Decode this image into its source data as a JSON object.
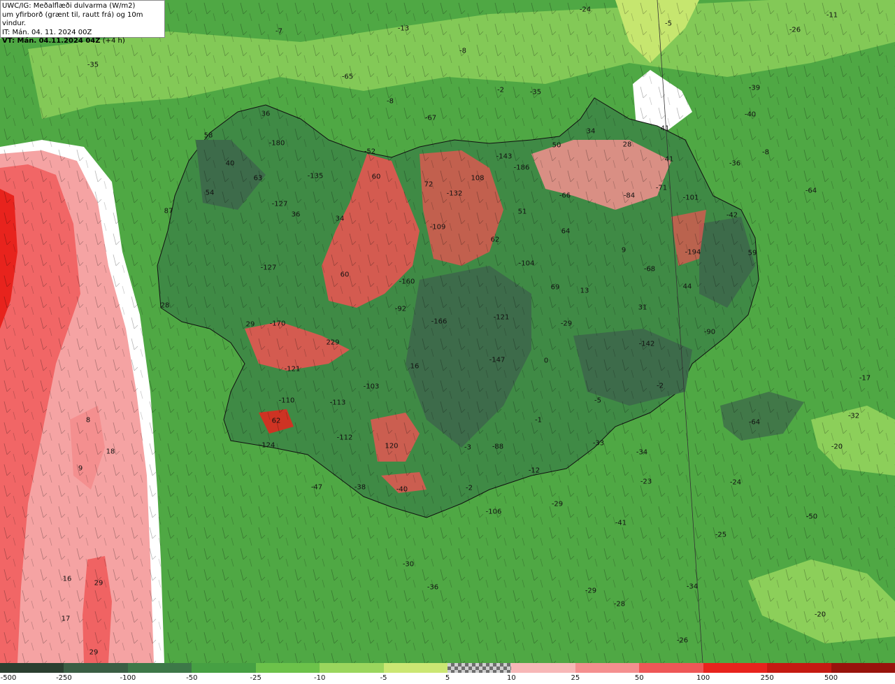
{
  "header": {
    "title_line1": "UWC/IG: Meðalflæði dulvarma (W/m2)",
    "title_line2": "um yfirborð (grænt til, rautt frá) og 10m vindur.",
    "init_time": "IT: Mán. 04. 11. 2024 00Z",
    "valid_time": "VT: Mán. 04.11.2024 04Z",
    "lead": "(+4 h)"
  },
  "colors": {
    "sea_green": "#4fa844",
    "light_green": "#8ccf5a",
    "yellow_green": "#c6e66f",
    "dark_green": "#3d6b4a",
    "mid_green": "#3f8a45",
    "pink": "#f5a3a3",
    "red": "#ef5252",
    "strong_red": "#e8231d"
  },
  "colorbar": {
    "ticks": [
      "-500",
      "-250",
      "-100",
      "-50",
      "-25",
      "-10",
      "-5",
      "5",
      "10",
      "25",
      "50",
      "100",
      "250",
      "500"
    ],
    "colors": [
      "#2b3f30",
      "#3a5e44",
      "#3d7848",
      "#46a043",
      "#6cc24a",
      "#9ad65d",
      "#cbe773",
      "checker",
      "#f7b7b7",
      "#f48f8f",
      "#ee5757",
      "#e8231d",
      "#c51a12",
      "#98130c"
    ]
  },
  "labels": [
    {
      "t": "-24"
    },
    {
      "t": "-5"
    },
    {
      "t": "-11"
    },
    {
      "t": "-26"
    },
    {
      "t": "-7"
    },
    {
      "t": "-13"
    },
    {
      "t": "-8"
    },
    {
      "t": "-35"
    },
    {
      "t": "-65"
    },
    {
      "t": "-2"
    },
    {
      "t": "-35"
    },
    {
      "t": "-8"
    },
    {
      "t": "-39"
    },
    {
      "t": "-40"
    },
    {
      "t": "-67"
    },
    {
      "t": "36"
    },
    {
      "t": "-8"
    },
    {
      "t": "58"
    },
    {
      "t": "-180"
    },
    {
      "t": "34"
    },
    {
      "t": "41"
    },
    {
      "t": "28"
    },
    {
      "t": "50"
    },
    {
      "t": "-52"
    },
    {
      "t": "-143"
    },
    {
      "t": "-186"
    },
    {
      "t": "41"
    },
    {
      "t": "-36"
    },
    {
      "t": "40"
    },
    {
      "t": "60"
    },
    {
      "t": "-135"
    },
    {
      "t": "63"
    },
    {
      "t": "72"
    },
    {
      "t": "-132"
    },
    {
      "t": "108"
    },
    {
      "t": "-71"
    },
    {
      "t": "-64"
    },
    {
      "t": "54"
    },
    {
      "t": "-66"
    },
    {
      "t": "-84"
    },
    {
      "t": "-101"
    },
    {
      "t": "-127"
    },
    {
      "t": "87"
    },
    {
      "t": "36"
    },
    {
      "t": "34"
    },
    {
      "t": "51"
    },
    {
      "t": "-42"
    },
    {
      "t": "-109"
    },
    {
      "t": "64"
    },
    {
      "t": "62"
    },
    {
      "t": "9"
    },
    {
      "t": "-194"
    },
    {
      "t": "59"
    },
    {
      "t": "-127"
    },
    {
      "t": "60"
    },
    {
      "t": "-104"
    },
    {
      "t": "-68"
    },
    {
      "t": "-160"
    },
    {
      "t": "69"
    },
    {
      "t": "13"
    },
    {
      "t": "44"
    },
    {
      "t": "28"
    },
    {
      "t": "-92"
    },
    {
      "t": "31"
    },
    {
      "t": "-166"
    },
    {
      "t": "-121"
    },
    {
      "t": "-29"
    },
    {
      "t": "-170"
    },
    {
      "t": "29"
    },
    {
      "t": "-90"
    },
    {
      "t": "229"
    },
    {
      "t": "-142"
    },
    {
      "t": "-147"
    },
    {
      "t": "0"
    },
    {
      "t": "16"
    },
    {
      "t": "-121"
    },
    {
      "t": "-17"
    },
    {
      "t": "-103"
    },
    {
      "t": "-2"
    },
    {
      "t": "-110"
    },
    {
      "t": "-113"
    },
    {
      "t": "-5"
    },
    {
      "t": "62"
    },
    {
      "t": "8"
    },
    {
      "t": "-1"
    },
    {
      "t": "-64"
    },
    {
      "t": "-32"
    },
    {
      "t": "-112"
    },
    {
      "t": "-124"
    },
    {
      "t": "120"
    },
    {
      "t": "-3"
    },
    {
      "t": "-88"
    },
    {
      "t": "-33"
    },
    {
      "t": "-20"
    },
    {
      "t": "18"
    },
    {
      "t": "-34"
    },
    {
      "t": "9"
    },
    {
      "t": "-12"
    },
    {
      "t": "-23"
    },
    {
      "t": "-24"
    },
    {
      "t": "-47"
    },
    {
      "t": "-38"
    },
    {
      "t": "-40"
    },
    {
      "t": "-2"
    },
    {
      "t": "-106"
    },
    {
      "t": "-29"
    },
    {
      "t": "-41"
    },
    {
      "t": "-50"
    },
    {
      "t": "-25"
    },
    {
      "t": "-30"
    },
    {
      "t": "-36"
    },
    {
      "t": "-34"
    },
    {
      "t": "16"
    },
    {
      "t": "29"
    },
    {
      "t": "-29"
    },
    {
      "t": "-28"
    },
    {
      "t": "-20"
    },
    {
      "t": "17"
    },
    {
      "t": "-26"
    },
    {
      "t": "29"
    }
  ]
}
